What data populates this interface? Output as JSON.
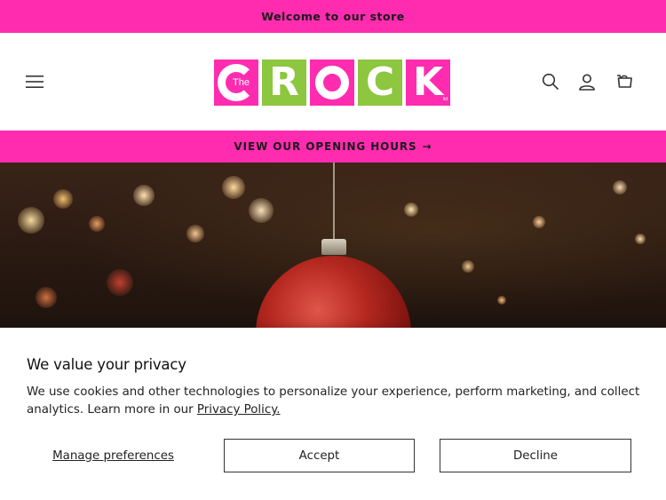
{
  "announcement": {
    "text": "Welcome to our store"
  },
  "header": {
    "menu_icon": "hamburger-menu-icon",
    "logo": {
      "tiles": [
        {
          "letter": "C",
          "color": "#ff2cb0",
          "small_text": "The"
        },
        {
          "letter": "R",
          "color": "#8dc63f"
        },
        {
          "letter": "O",
          "color": "#ff2cb0"
        },
        {
          "letter": "C",
          "color": "#8dc63f"
        },
        {
          "letter": "K",
          "color": "#ff2cb0",
          "small_text": "ltd"
        }
      ]
    },
    "search_icon": "search-icon",
    "account_icon": "account-icon",
    "cart_icon": "cart-icon"
  },
  "hours_bar": {
    "label": "VIEW OUR OPENING HOURS",
    "arrow": "→"
  },
  "hero": {
    "image": "christmas-ornament-bokeh"
  },
  "consent": {
    "title": "We value your privacy",
    "body": "We use cookies and other technologies to personalize your experience, perform marketing, and collect analytics. Learn more in our ",
    "link_label": "Privacy Policy.",
    "manage_label": "Manage preferences",
    "accept_label": "Accept",
    "decline_label": "Decline"
  },
  "colors": {
    "brand_pink": "#ff2cb0",
    "brand_green": "#8dc63f"
  }
}
